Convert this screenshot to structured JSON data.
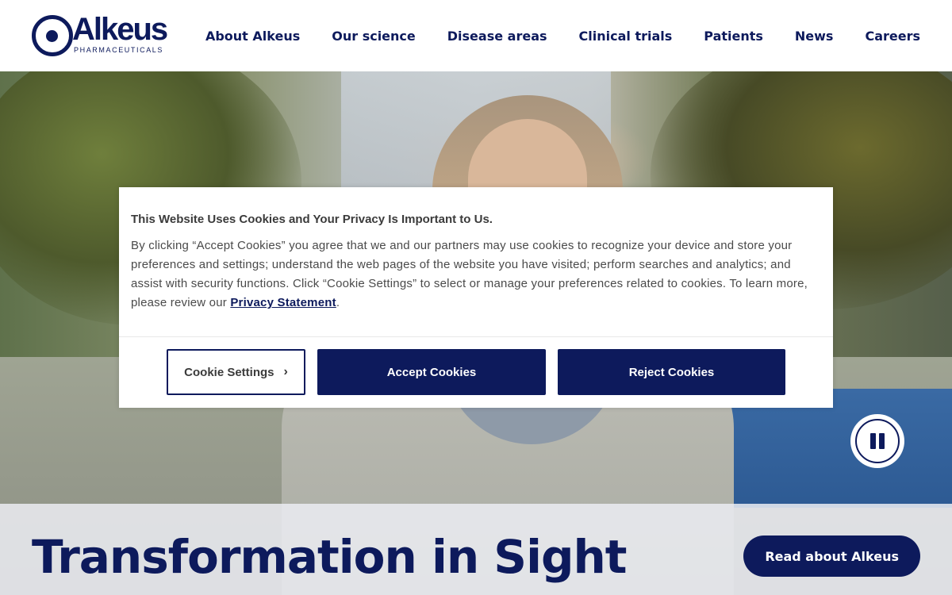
{
  "brand": {
    "name": "Alkeus",
    "tagline": "PHARMACEUTICALS",
    "primary_color": "#0d1a5c"
  },
  "nav": {
    "items": [
      {
        "label": "About Alkeus"
      },
      {
        "label": "Our science"
      },
      {
        "label": "Disease areas"
      },
      {
        "label": "Clinical trials"
      },
      {
        "label": "Patients"
      },
      {
        "label": "News"
      },
      {
        "label": "Careers"
      }
    ]
  },
  "hero": {
    "title": "Transformation in Sight",
    "cta_label": "Read about Alkeus",
    "pause_icon": "pause-icon"
  },
  "cookie_banner": {
    "title": "This Website Uses Cookies and Your Privacy Is Important to Us.",
    "body": "By clicking “Accept Cookies” you agree that we and our partners may use cookies to recognize your device and store your preferences and settings; understand the web pages of the website you have visited; perform searches and analytics; and assist with security functions. Click “Cookie Settings” to select or manage your preferences related to cookies. To learn more, please review our",
    "link_label": "Privacy Statement",
    "body_end": ".",
    "settings_label": "Cookie Settings",
    "accept_label": "Accept Cookies",
    "reject_label": "Reject Cookies"
  }
}
